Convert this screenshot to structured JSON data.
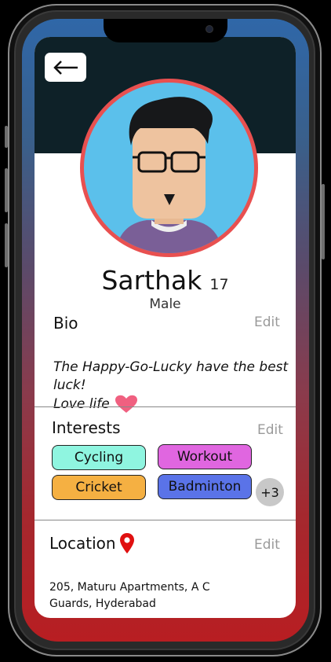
{
  "profile": {
    "name": "Sarthak",
    "age": "17",
    "gender": "Male"
  },
  "bio": {
    "title": "Bio",
    "edit_label": "Edit",
    "line1": "The Happy-Go-Lucky have the best luck!",
    "line2": "Love life"
  },
  "interests": {
    "title": "Interests",
    "edit_label": "Edit",
    "items": [
      {
        "label": "Cycling",
        "color": "#8ff5e0"
      },
      {
        "label": "Workout",
        "color": "#e066e0"
      },
      {
        "label": "Cricket",
        "color": "#f5b042"
      },
      {
        "label": "Badminton",
        "color": "#5a73e8"
      }
    ],
    "more_label": "+3"
  },
  "location": {
    "title": "Location",
    "edit_label": "Edit",
    "address": "205, Maturu Apartments, A C Guards, Hyderabad"
  },
  "colors": {
    "header": "#0e2128",
    "avatar_ring": "#e85050",
    "avatar_bg": "#5bc0eb",
    "heart": "#f06080",
    "location_pin": "#e01010"
  },
  "icons": {
    "back": "back-arrow-icon",
    "heart": "heart-icon",
    "location": "location-pin-icon"
  }
}
